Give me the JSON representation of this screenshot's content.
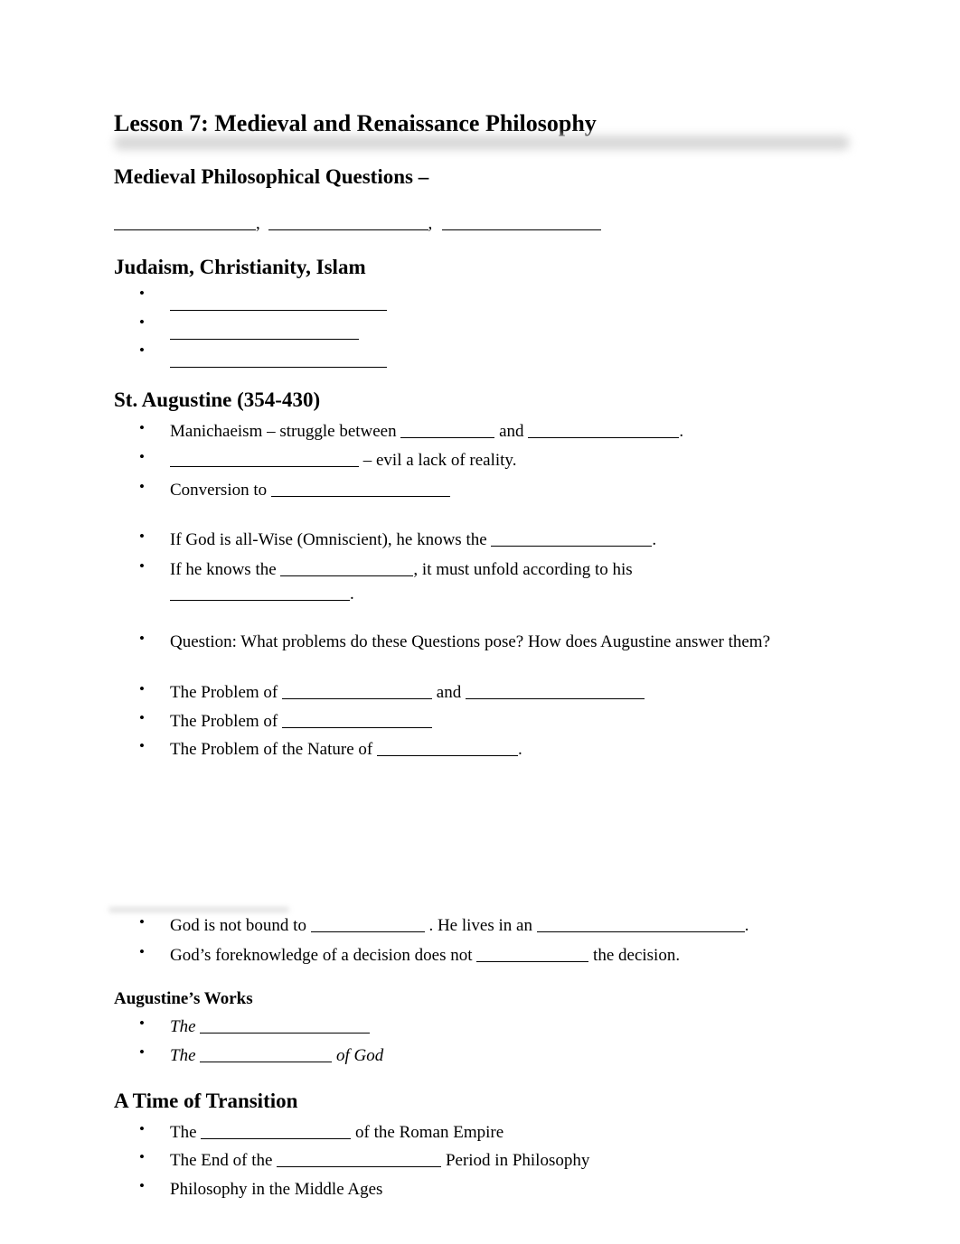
{
  "title": "Lesson 7:  Medieval and Renaissance Philosophy",
  "sections": {
    "medieval_questions": {
      "heading": "Medieval Philosophical Questions –",
      "blanks_line": [
        "",
        ",",
        ","
      ]
    },
    "religions": {
      "heading": "Judaism, Christianity, Islam",
      "items": [
        "",
        "",
        ""
      ]
    },
    "augustine": {
      "heading": "St. Augustine (354-430)",
      "items": [
        {
          "pre": "Manichaeism – struggle between ",
          "mid": " and ",
          "post": "."
        },
        {
          "pre": "",
          "post": " – evil a lack of reality."
        },
        {
          "pre": "Conversion to ",
          "post": ""
        },
        {
          "pre": "If God is all-Wise (Omniscient), he knows the ",
          "post": "."
        },
        {
          "pre": "If he knows the ",
          "mid": ", it must unfold according to his",
          "post": "."
        },
        {
          "text": "Question:  What problems do these Questions pose?  How does Augustine answer them?"
        },
        {
          "pre": "The Problem of ",
          "mid": " and ",
          "post": ""
        },
        {
          "pre": "The Problem of ",
          "post": ""
        },
        {
          "pre": "The Problem of the Nature of ",
          "post": "."
        },
        {
          "pre": "God is not bound to ",
          "mid": " .  He lives in an ",
          "post": "."
        },
        {
          "pre": "God’s foreknowledge of a decision does not ",
          "post": " the decision."
        }
      ]
    },
    "works": {
      "heading": "Augustine’s Works",
      "items": [
        {
          "pre": "The ",
          "post": ""
        },
        {
          "pre": "The ",
          "post": " of God"
        }
      ]
    },
    "transition": {
      "heading": "A Time of Transition",
      "items": [
        {
          "pre": "The ",
          "post": " of the Roman Empire"
        },
        {
          "pre": "The End of the ",
          "post": " Period in Philosophy"
        },
        {
          "text": "Philosophy in the Middle Ages"
        }
      ]
    }
  },
  "bullet_glyph": "•"
}
